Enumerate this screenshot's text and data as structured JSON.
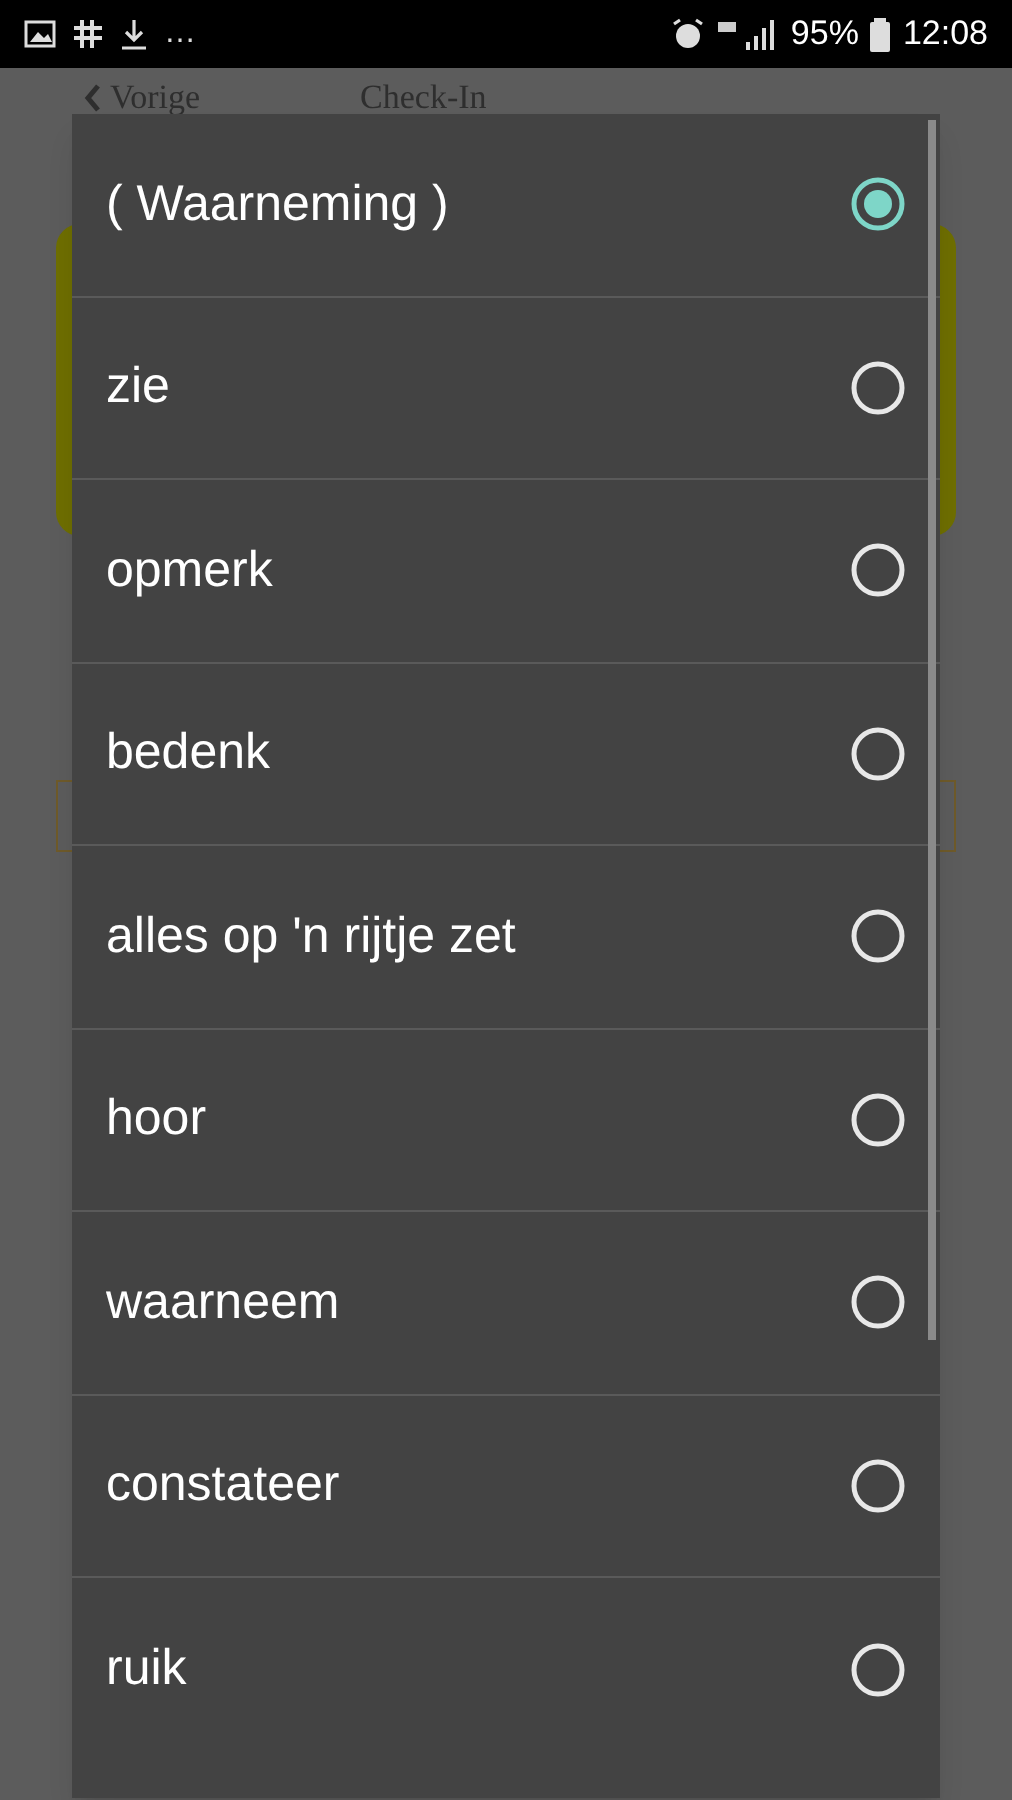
{
  "status_bar": {
    "overflow": "…",
    "battery": "95%",
    "time": "12:08"
  },
  "header": {
    "back_label": "Vorige",
    "title": "Check-In"
  },
  "options": [
    {
      "label": "( Waarneming )",
      "selected": true
    },
    {
      "label": "zie",
      "selected": false
    },
    {
      "label": "opmerk",
      "selected": false
    },
    {
      "label": "bedenk",
      "selected": false
    },
    {
      "label": "alles op 'n rijtje zet",
      "selected": false
    },
    {
      "label": "hoor",
      "selected": false
    },
    {
      "label": "waarneem",
      "selected": false
    },
    {
      "label": "constateer",
      "selected": false
    },
    {
      "label": "ruik",
      "selected": false
    }
  ]
}
